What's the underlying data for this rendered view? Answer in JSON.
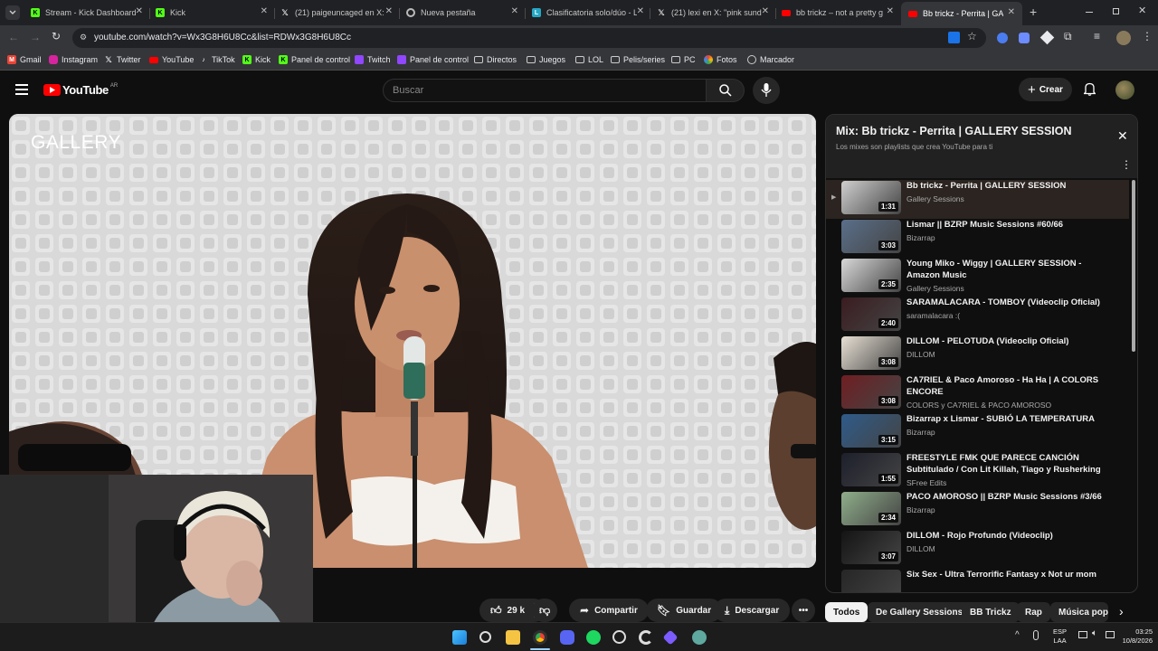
{
  "browser": {
    "tabs": [
      {
        "title": "Stream - Kick Dashboard",
        "icon": "kick-icon"
      },
      {
        "title": "Kick",
        "icon": "kick-icon"
      },
      {
        "title": "(21) paigeuncaged en X:",
        "icon": "x-icon"
      },
      {
        "title": "Nueva pestaña",
        "icon": "chrome-icon"
      },
      {
        "title": "Clasificatoria solo/dúo - L",
        "icon": "leaguepedia-icon"
      },
      {
        "title": "(21) lexi en X: \"pink sunda",
        "icon": "x-icon"
      },
      {
        "title": "bb trickz – not a pretty g",
        "icon": "youtube-icon"
      },
      {
        "title": "Bb trickz - Perrita | GA",
        "icon": "youtube-icon"
      }
    ],
    "url": "youtube.com/watch?v=Wx3G8H6U8Cc&list=RDWx3G8H6U8Cc",
    "bookmarks": [
      {
        "label": "Gmail",
        "icon": "gmail-icon"
      },
      {
        "label": "Instagram",
        "icon": "instagram-icon"
      },
      {
        "label": "Twitter",
        "icon": "x-icon"
      },
      {
        "label": "YouTube",
        "icon": "youtube-icon"
      },
      {
        "label": "TikTok",
        "icon": "tiktok-icon"
      },
      {
        "label": "Kick",
        "icon": "kick-icon"
      },
      {
        "label": "Panel de control",
        "icon": "kick-icon"
      },
      {
        "label": "Twitch",
        "icon": "twitch-icon"
      },
      {
        "label": "Panel de control",
        "icon": "twitch-icon"
      },
      {
        "label": "Directos",
        "icon": "folder-icon"
      },
      {
        "label": "Juegos",
        "icon": "folder-icon"
      },
      {
        "label": "LOL",
        "icon": "folder-icon"
      },
      {
        "label": "Pelis/series",
        "icon": "folder-icon"
      },
      {
        "label": "PC",
        "icon": "folder-icon"
      },
      {
        "label": "Fotos",
        "icon": "photos-icon"
      },
      {
        "label": "Marcador",
        "icon": "bookmark-icon"
      }
    ]
  },
  "youtube": {
    "logo_text": "YouTube",
    "region": "AR",
    "search_placeholder": "Buscar",
    "create_label": "Crear"
  },
  "video": {
    "watermark": "GALLERY"
  },
  "actions": {
    "likes": "29 k",
    "share": "Compartir",
    "save": "Guardar",
    "download": "Descargar"
  },
  "playlist": {
    "title": "Mix: Bb trickz - Perrita | GALLERY SESSION",
    "subtitle": "Los mixes son playlists que crea YouTube para ti",
    "items": [
      {
        "title": "Bb trickz - Perrita | GALLERY SESSION",
        "channel": "Gallery Sessions",
        "duration": "1:31"
      },
      {
        "title": "Lismar || BZRP Music Sessions #60/66",
        "channel": "Bizarrap",
        "duration": "3:03"
      },
      {
        "title": "Young Miko - Wiggy | GALLERY SESSION - Amazon Music",
        "channel": "Gallery Sessions",
        "duration": "2:35"
      },
      {
        "title": "SARAMALACARA - TOMBOY (Videoclip Oficial)",
        "channel": "saramalacara :(",
        "duration": "2:40"
      },
      {
        "title": "DILLOM - PELOTUDA (Videoclip Oficial)",
        "channel": "DILLOM",
        "duration": "3:08"
      },
      {
        "title": "CA7RIEL & Paco Amoroso - Ha Ha | A COLORS ENCORE",
        "channel": "COLORS y CA7RIEL & PACO AMOROSO",
        "duration": "3:08"
      },
      {
        "title": "Bizarrap x Lismar - SUBIÓ LA TEMPERATURA",
        "channel": "Bizarrap",
        "duration": "3:15"
      },
      {
        "title": "FREESTYLE FMK QUE PARECE CANCIÓN Subtitulado / Con Lit Killah, Tiago y Rusherking /...",
        "channel": "SFree Edits",
        "duration": "1:55"
      },
      {
        "title": "PACO AMOROSO || BZRP Music Sessions #3/66",
        "channel": "Bizarrap",
        "duration": "2:34"
      },
      {
        "title": "DILLOM - Rojo Profundo (Videoclip)",
        "channel": "DILLOM",
        "duration": "3:07"
      },
      {
        "title": "Six Sex - Ultra Terrorific Fantasy x Not ur mom",
        "channel": "",
        "duration": ""
      }
    ]
  },
  "chips": [
    "Todos",
    "De Gallery Sessions",
    "BB Trickz",
    "Rap",
    "Música pop"
  ],
  "taskbar": {
    "lang_top": "ESP",
    "lang_bottom": "LAA",
    "time": "03:25",
    "date": "10/8/2026"
  },
  "colors": {
    "yt_red": "#ff0000",
    "kick_green": "#53fc18",
    "bg": "#0f0f0f"
  }
}
